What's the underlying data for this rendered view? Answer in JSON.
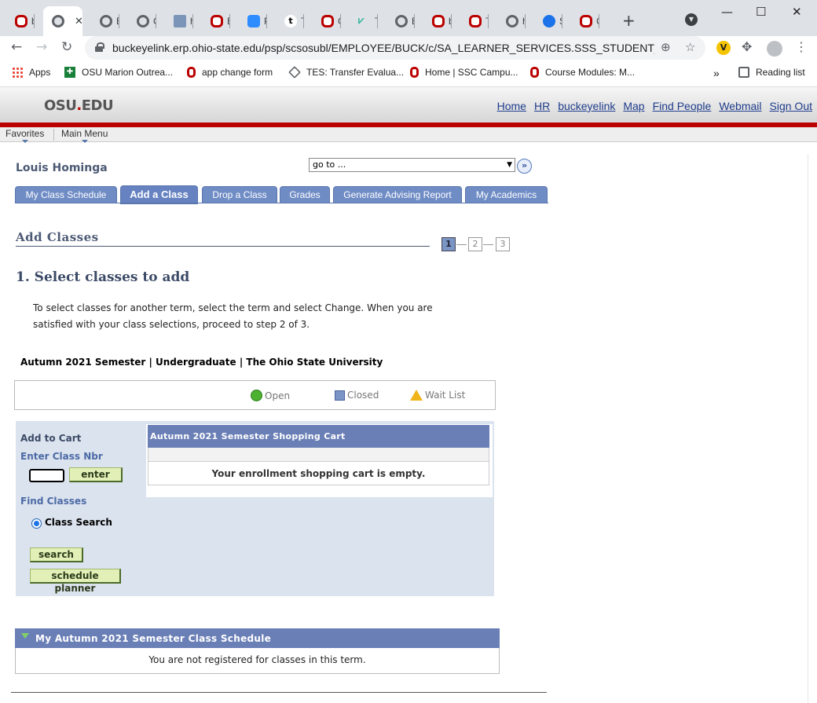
{
  "browser": {
    "tabs": [
      {
        "title": "bu",
        "icon": "osu-icon"
      },
      {
        "title": "h",
        "icon": "globe-icon",
        "active": true
      },
      {
        "title": "Er",
        "icon": "globe-icon"
      },
      {
        "title": "O",
        "icon": "globe-icon"
      },
      {
        "title": "h",
        "icon": "image-icon"
      },
      {
        "title": "Ex",
        "icon": "osu-icon"
      },
      {
        "title": "Pe",
        "icon": "zoom-icon"
      },
      {
        "title": "Te",
        "icon": "t-icon"
      },
      {
        "title": "G",
        "icon": "osu-icon"
      },
      {
        "title": "Tr",
        "icon": "tr-icon"
      },
      {
        "title": "El",
        "icon": "globe-icon"
      },
      {
        "title": "bu",
        "icon": "osu-icon"
      },
      {
        "title": "Tl",
        "icon": "osu-icon"
      },
      {
        "title": "ht",
        "icon": "globe-icon"
      },
      {
        "title": "St",
        "icon": "web-icon"
      },
      {
        "title": "C",
        "icon": "osu-icon"
      }
    ],
    "close_tab": "✕",
    "new_tab": "+",
    "url": "buckeyelink.erp.ohio-state.edu/psp/scsosubl/EMPLOYEE/BUCK/c/SA_LEARNER_SERVICES.SSS_STUDENT_CEN...",
    "bookmarks": [
      {
        "label": "Apps"
      },
      {
        "label": "OSU Marion Outrea..."
      },
      {
        "label": "app change form"
      },
      {
        "label": "TES: Transfer Evalua..."
      },
      {
        "label": "Home | SSC Campu..."
      },
      {
        "label": "Course Modules: M..."
      }
    ],
    "bookmarks_more": "»",
    "reading_list": "Reading list",
    "colors": {
      "tabstrip": "#dee1e6",
      "osu_red": "#bb0000"
    }
  },
  "osu": {
    "logo_prefix": "OSU",
    "logo_dot": ".",
    "logo_suffix": "EDU",
    "top_links": [
      "Home",
      "HR",
      "buckeyelink",
      "Map",
      "Find People",
      "Webmail",
      "Sign Out"
    ],
    "menu": {
      "favorites": "Favorites",
      "main_menu": "Main Menu"
    }
  },
  "page": {
    "student_name": "Louis Hominga",
    "goto_value": "go to ...",
    "tabs": [
      {
        "label": "My Class Schedule"
      },
      {
        "label": "Add a Class",
        "active": true
      },
      {
        "label": "Drop a Class"
      },
      {
        "label": "Grades"
      },
      {
        "label": "Generate Advising Report"
      },
      {
        "label": "My Academics"
      }
    ],
    "section_title": "Add Classes",
    "steps": [
      "1",
      "2",
      "3"
    ],
    "current_step": 1,
    "heading": "1.  Select classes to add",
    "instructions_line1": "To select classes for another term, select the term and select Change.  When you are",
    "instructions_line2": "satisfied with your class selections, proceed to step 2 of 3.",
    "term_info": "Autumn 2021 Semester | Undergraduate | The Ohio State University",
    "legend": {
      "open": "Open",
      "closed": "Closed",
      "wait": "Wait List"
    },
    "add_to_cart": "Add to Cart",
    "enter_class_nbr": "Enter Class Nbr",
    "class_nbr_value": "",
    "enter_button": "enter",
    "find_classes": "Find Classes",
    "class_search_option": "Class Search",
    "search_button": "search",
    "schedule_planner_button": "schedule planner",
    "cart_header": "Autumn 2021 Semester Shopping Cart",
    "cart_empty": "Your enrollment shopping cart is empty.",
    "schedule_header": "My Autumn 2021 Semester Class Schedule",
    "schedule_empty": "You are not registered for classes in this term."
  }
}
